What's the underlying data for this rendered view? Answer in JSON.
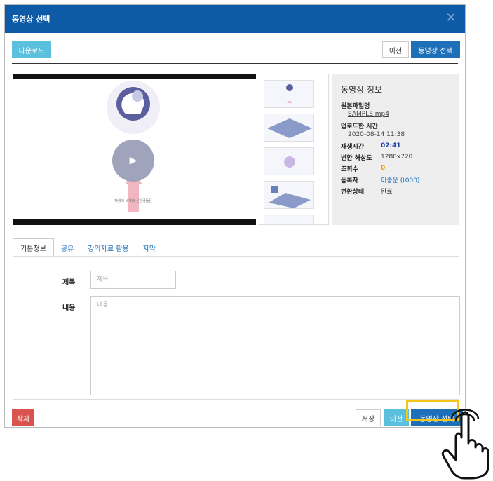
{
  "dialog": {
    "title": "동영상 선택",
    "close_glyph": "✕"
  },
  "toolbar": {
    "download_label": "다운로드",
    "prev_label": "이전",
    "select_label": "동영상 선택"
  },
  "player": {
    "caption": "재생에 세계와 신한국들은",
    "play_glyph": "▶"
  },
  "info": {
    "heading": "동영상 정보",
    "original_filename_label": "원본파일명",
    "original_filename": "SAMPLE.mp4",
    "upload_time_label": "업로드한 시간",
    "upload_time": "2020-08-14 11:38",
    "duration_label": "재생시간",
    "duration": "02:41",
    "resolution_label": "변환 해상도",
    "resolution": "1280x720",
    "views_label": "조회수",
    "views": "0",
    "registrant_label": "등록자",
    "registrant": "이종운 (t000)",
    "status_label": "변환상태",
    "status": "완료",
    "colors": {
      "duration": "#1d3fa8",
      "views": "#e8a000",
      "registrant": "#1d6fb8"
    }
  },
  "tabs": [
    {
      "label": "기본정보",
      "active": true
    },
    {
      "label": "공유",
      "active": false
    },
    {
      "label": "강의자료 활용",
      "active": false
    },
    {
      "label": "자막",
      "active": false
    }
  ],
  "form": {
    "title_label": "제목",
    "title_placeholder": "제목",
    "content_label": "내용",
    "content_placeholder": "내용"
  },
  "footer": {
    "delete_label": "삭제",
    "save_label": "저장",
    "prev_label": "이전",
    "select_label": "동영상 선택"
  },
  "colors": {
    "titlebar": "#0d5aa7",
    "highlight": "#f5c518"
  }
}
